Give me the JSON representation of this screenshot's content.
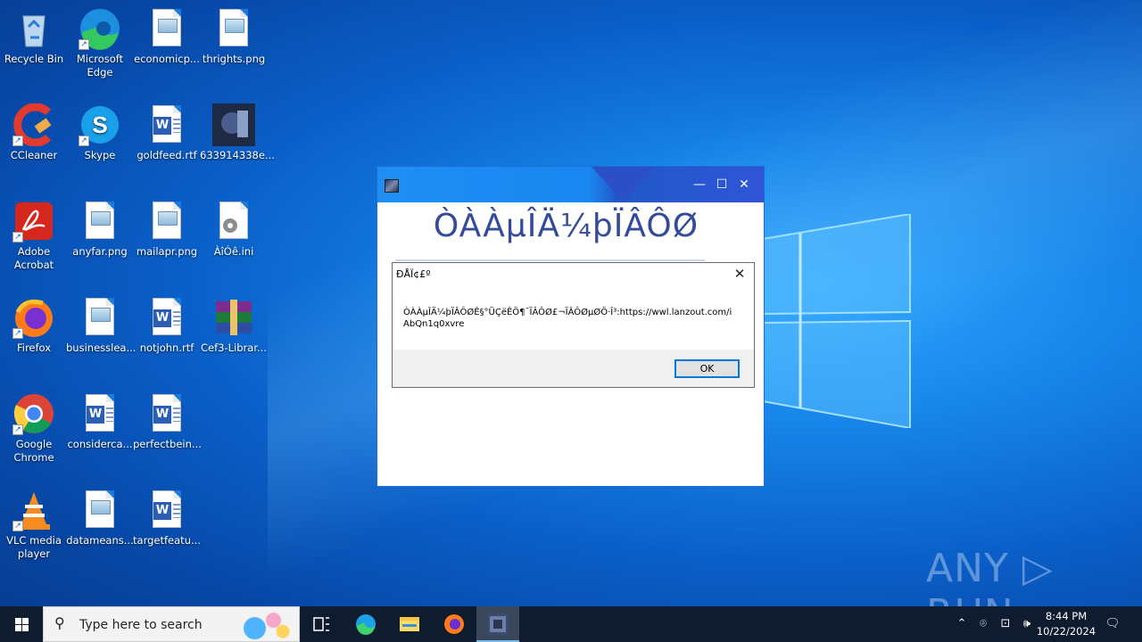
{
  "desktop": {
    "icons": [
      {
        "label": "Recycle Bin",
        "icon": "recycle-bin-icon"
      },
      {
        "label": "Microsoft Edge",
        "icon": "edge-icon"
      },
      {
        "label": "economicp...",
        "icon": "image-file-icon"
      },
      {
        "label": "thrights.png",
        "icon": "image-file-icon"
      },
      {
        "label": "CCleaner",
        "icon": "ccleaner-icon"
      },
      {
        "label": "Skype",
        "icon": "skype-icon"
      },
      {
        "label": "goldfeed.rtf",
        "icon": "word-doc-icon"
      },
      {
        "label": "633914338e...",
        "icon": "image-thumbnail-icon"
      },
      {
        "label": "Adobe Acrobat",
        "icon": "acrobat-icon"
      },
      {
        "label": "anyfar.png",
        "icon": "image-file-icon"
      },
      {
        "label": "mailapr.png",
        "icon": "image-file-icon"
      },
      {
        "label": "ÀîÓê.ini",
        "icon": "settings-file-icon"
      },
      {
        "label": "Firefox",
        "icon": "firefox-icon"
      },
      {
        "label": "businesslea...",
        "icon": "image-file-icon"
      },
      {
        "label": "notjohn.rtf",
        "icon": "word-doc-icon"
      },
      {
        "label": "Cef3-Librar...",
        "icon": "winrar-icon"
      },
      {
        "label": "Google Chrome",
        "icon": "chrome-icon"
      },
      {
        "label": "considerca...",
        "icon": "word-doc-icon"
      },
      {
        "label": "perfectbein...",
        "icon": "word-doc-icon"
      },
      {
        "label": "VLC media player",
        "icon": "vlc-icon"
      },
      {
        "label": "datameans...",
        "icon": "image-file-icon"
      },
      {
        "label": "targetfeatu...",
        "icon": "word-doc-icon"
      }
    ]
  },
  "app_window": {
    "heading": "ÒÀÀµÎÄ¼þÏÂÔØ",
    "minimize": "—",
    "maximize": "☐",
    "close": "✕"
  },
  "message_box": {
    "title": "ÐÅÏ¢£º",
    "text": "ÒÀÀµÎÄ¼þÏÂÔØÊ§°ÜÇëÊÖ¶¯ÏÂÔØ£¬ÏÂÔØµØÖ·Î³:https://wwl.lanzout.com/iAbQn1q0xvre",
    "ok_label": "OK",
    "close": "✕"
  },
  "watermark": "ANY ▷ RUN",
  "taskbar": {
    "search_placeholder": "Type here to search",
    "time": "8:44 PM",
    "date": "10/22/2024",
    "colors": {
      "background": "#0f1b2e",
      "accent": "#76b9ed"
    }
  }
}
